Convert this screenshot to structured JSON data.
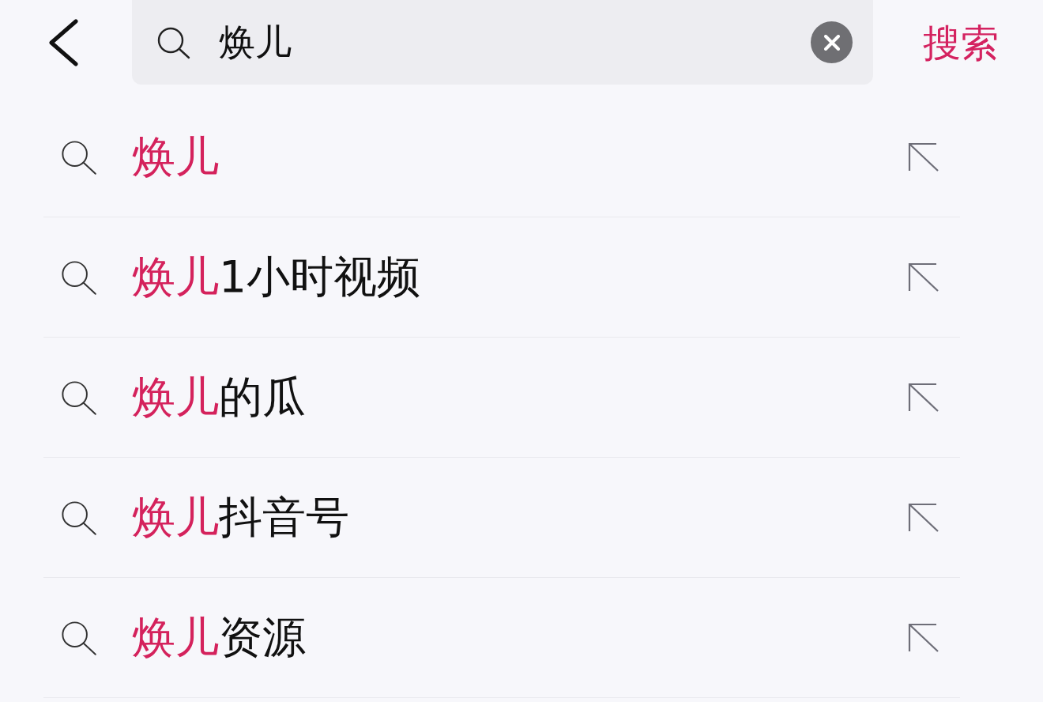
{
  "search_bar": {
    "query": "焕儿",
    "search_button": "搜索"
  },
  "suggestions": [
    {
      "highlight": "焕儿"
    },
    {
      "highlight": "焕儿",
      "rest": "1小时视频"
    },
    {
      "highlight": "焕儿",
      "rest": "的瓜"
    },
    {
      "highlight": "焕儿",
      "rest": "抖音号"
    },
    {
      "highlight": "焕儿",
      "rest": "资源"
    }
  ]
}
